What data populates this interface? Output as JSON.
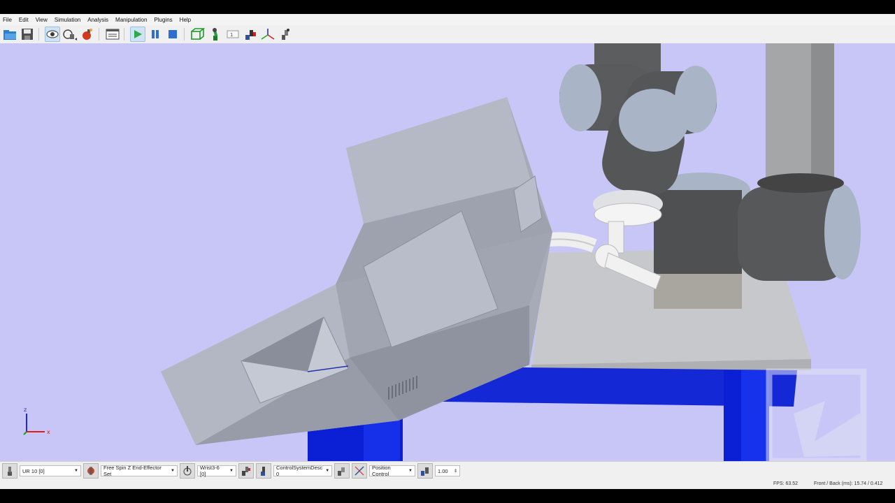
{
  "menu": [
    "File",
    "Edit",
    "View",
    "Simulation",
    "Analysis",
    "Manipulation",
    "Plugins",
    "Help"
  ],
  "toolbar_icons": [
    "open-icon",
    "save-icon",
    "eye-icon",
    "camera-icon",
    "bomb-icon",
    "display-settings-icon",
    "play-icon",
    "pause-icon",
    "stop-icon",
    "box-icon",
    "robot-icon",
    "frame-icon",
    "manipulator-icon",
    "axis-icon",
    "joint-icon"
  ],
  "axes": {
    "z": "z",
    "x": "x"
  },
  "statusbar": {
    "robot": "UR 10 [0]",
    "end_effector": "Free Spin Z End-Effector Set",
    "link": "Wrist3-6 [0]",
    "control_system": "ControlSystemDesc 0",
    "control_mode": "Position Control",
    "speed": "1.00"
  },
  "info": {
    "fps": "FPS: 63.52",
    "front_back": "Front / Back (ms):  15.74 / 0.412"
  },
  "colors": {
    "viewport_bg": "#c8c6f6",
    "table_leg": "#0b1fd4",
    "part": "#a6aab6",
    "robot_dark": "#555658",
    "robot_cap": "#a9b5c6"
  }
}
